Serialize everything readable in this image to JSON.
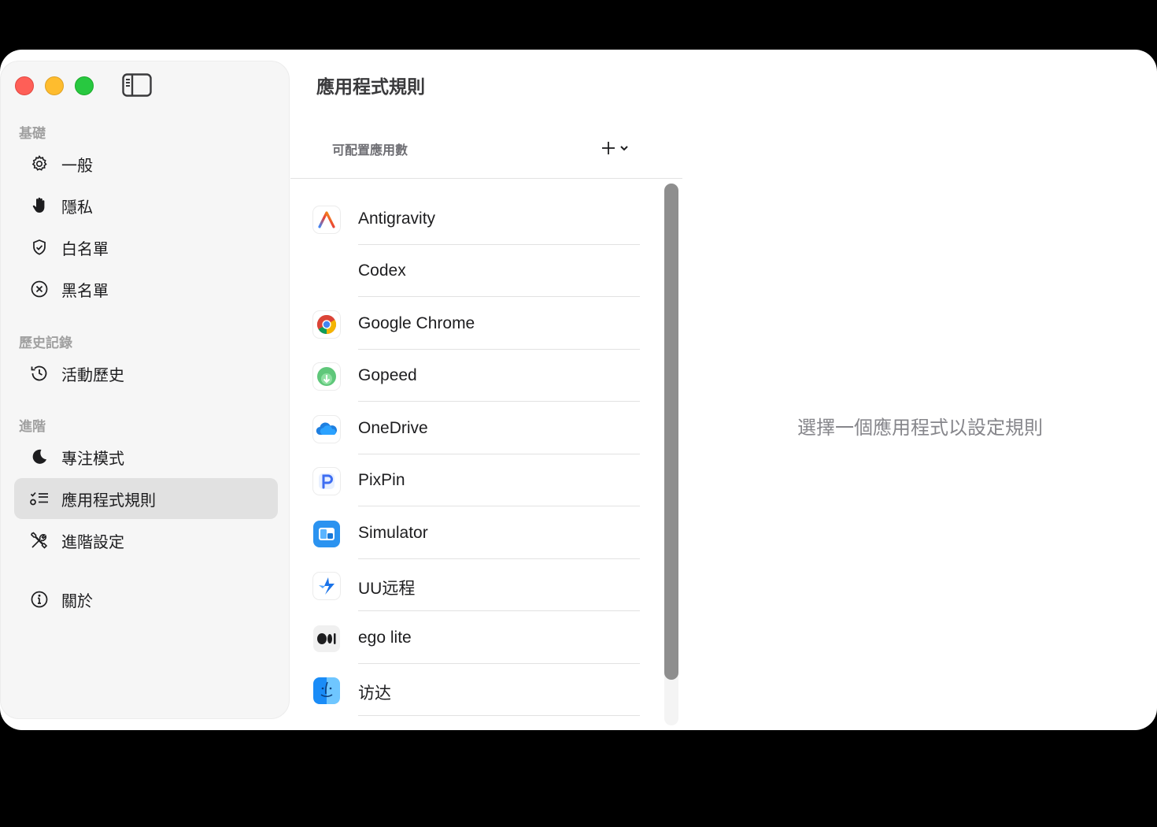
{
  "window": {
    "title": "應用程式規則"
  },
  "sidebar": {
    "sections": [
      {
        "label": "基礎"
      },
      {
        "label": "歷史記錄"
      },
      {
        "label": "進階"
      }
    ],
    "items": [
      {
        "label": "一般",
        "icon": "gear-icon"
      },
      {
        "label": "隱私",
        "icon": "hand-icon"
      },
      {
        "label": "白名單",
        "icon": "shield-check-icon"
      },
      {
        "label": "黑名單",
        "icon": "x-circle-icon"
      },
      {
        "label": "活動歷史",
        "icon": "history-icon"
      },
      {
        "label": "專注模式",
        "icon": "moon-icon"
      },
      {
        "label": "應用程式規則",
        "icon": "list-rules-icon",
        "active": true
      },
      {
        "label": "進階設定",
        "icon": "tools-icon"
      },
      {
        "label": "關於",
        "icon": "info-icon"
      }
    ]
  },
  "list": {
    "header_label": "可配置應用數",
    "add_icon": "plus-icon",
    "apps": [
      {
        "name": "Antigravity",
        "icon": "antigravity-app-icon"
      },
      {
        "name": "Codex",
        "icon": ""
      },
      {
        "name": "Google Chrome",
        "icon": "chrome-app-icon"
      },
      {
        "name": "Gopeed",
        "icon": "gopeed-app-icon"
      },
      {
        "name": "OneDrive",
        "icon": "onedrive-app-icon"
      },
      {
        "name": "PixPin",
        "icon": "pixpin-app-icon"
      },
      {
        "name": "Simulator",
        "icon": "simulator-app-icon"
      },
      {
        "name": "UU远程",
        "icon": "uu-remote-app-icon"
      },
      {
        "name": "ego lite",
        "icon": "ego-lite-app-icon"
      },
      {
        "name": "访达",
        "icon": "finder-app-icon"
      }
    ]
  },
  "detail": {
    "empty_hint": "選擇一個應用程式以設定規則"
  },
  "colors": {
    "active_item_bg": "#e1e1e1",
    "scrollbar_thumb": "#8e8e8e"
  }
}
